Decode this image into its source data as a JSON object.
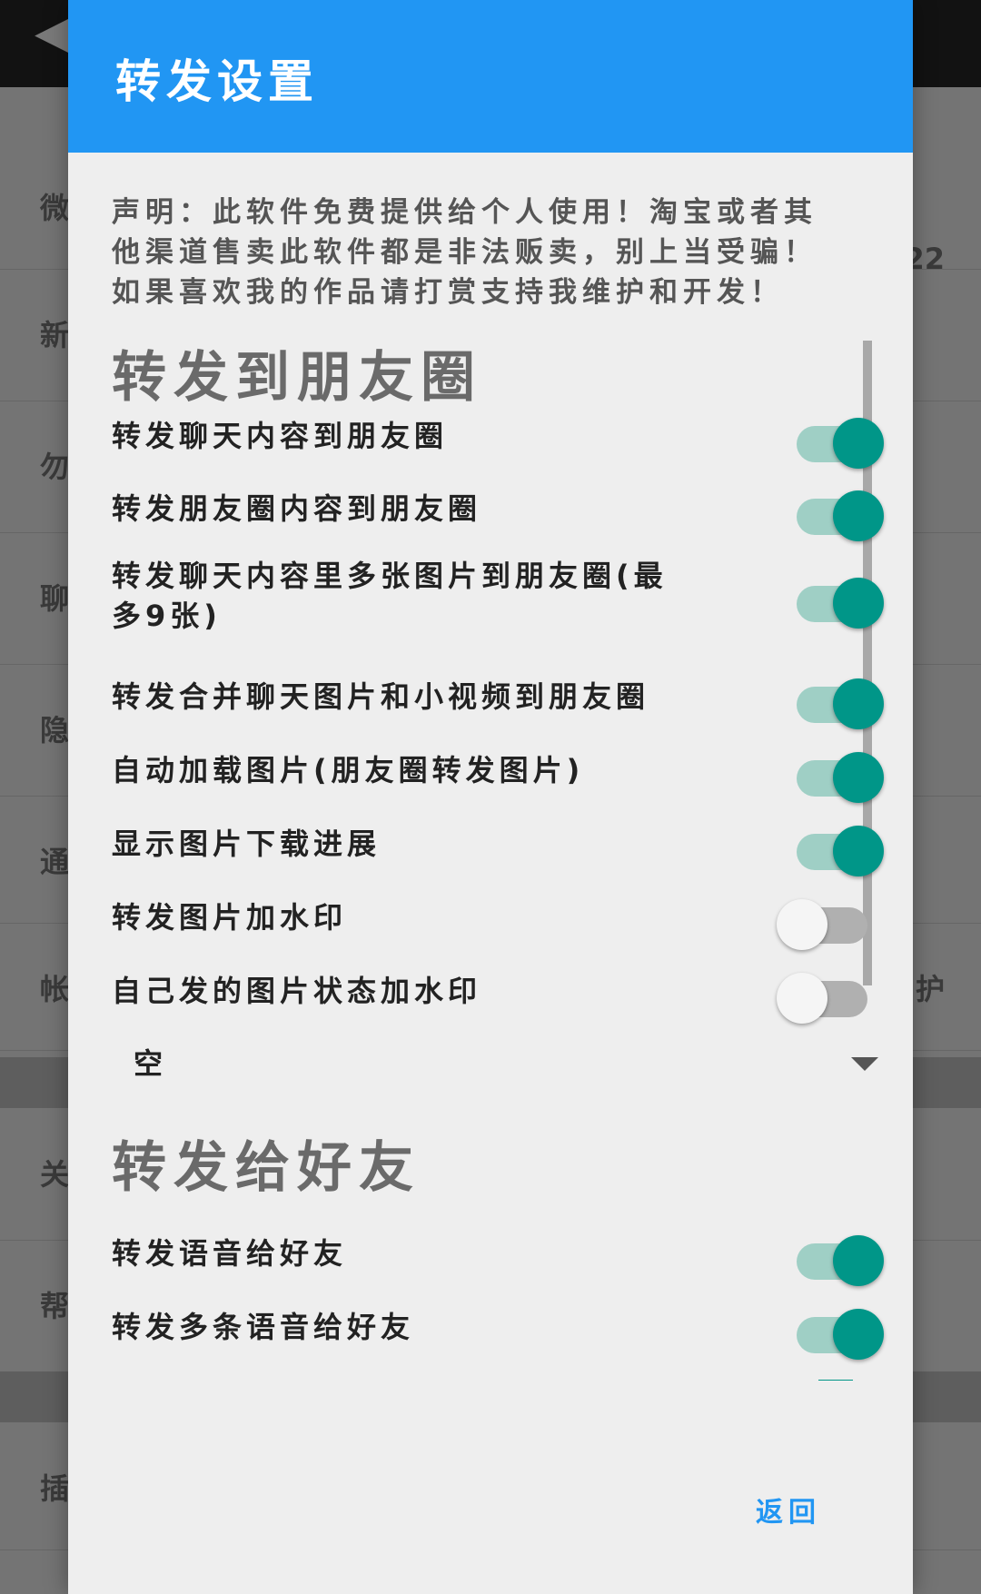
{
  "background": {
    "rows": [
      {
        "left": "微",
        "right": "22"
      },
      {
        "left": "新",
        "right": ""
      },
      {
        "left": "勿",
        "right": ""
      },
      {
        "left": "聊",
        "right": ""
      },
      {
        "left": "隐",
        "right": ""
      },
      {
        "left": "通",
        "right": ""
      },
      {
        "left": "帐",
        "right": "护"
      },
      {
        "left": "关",
        "right": ""
      },
      {
        "left": "帮",
        "right": ""
      },
      {
        "left": "插",
        "right": ""
      }
    ]
  },
  "dialog": {
    "title": "转发设置",
    "notice": "声明：此软件免费提供给个人使用！淘宝或者其他渠道售卖此软件都是非法贩卖，别上当受骗！如果喜欢我的作品请打赏支持我维护和开发！",
    "sections": [
      {
        "title": "转发到朋友圈",
        "items": [
          {
            "label": "转发聊天内容到朋友圈",
            "on": true
          },
          {
            "label": "转发朋友圈内容到朋友圈",
            "on": true
          },
          {
            "label": "转发聊天内容里多张图片到朋友圈(最多9张)",
            "on": true
          },
          {
            "label": "转发合并聊天图片和小视频到朋友圈",
            "on": true
          },
          {
            "label": "自动加载图片(朋友圈转发图片)",
            "on": true
          },
          {
            "label": "显示图片下载进展",
            "on": true
          },
          {
            "label": "转发图片加水印",
            "on": false
          },
          {
            "label": "自己发的图片状态加水印",
            "on": false
          }
        ],
        "dropdown_value": "空"
      },
      {
        "title": "转发给好友",
        "items": [
          {
            "label": "转发语音给好友",
            "on": true
          },
          {
            "label": "转发多条语音给好友",
            "on": true
          }
        ]
      }
    ],
    "back_label": "返回"
  },
  "colors": {
    "header": "#2196f3",
    "switch_on": "#009688",
    "switch_on_track": "#9fcfc5",
    "switch_off_track": "#b0b0b0",
    "button_text": "#2196f3"
  }
}
